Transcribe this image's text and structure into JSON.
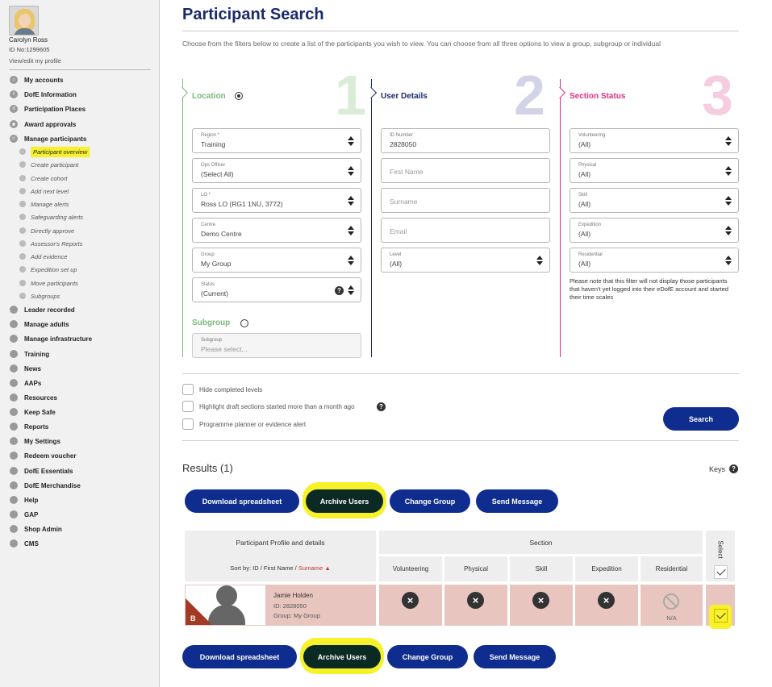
{
  "sidebar": {
    "user_name": "Carolyn Ross",
    "user_id": "ID No:1299605",
    "profile_link": "View/edit my profile",
    "nav": [
      {
        "label": "My accounts",
        "icon": "home-icon"
      },
      {
        "label": "DofE Information",
        "icon": "info-icon"
      },
      {
        "label": "Participation Places",
        "icon": "list-icon"
      },
      {
        "label": "Award approvals",
        "icon": "award-icon"
      },
      {
        "label": "Manage participants",
        "icon": "users-icon"
      }
    ],
    "sub_items": [
      "Participant overview",
      "Create participant",
      "Create cohort",
      "Add next level",
      "Manage alerts",
      "Safeguarding alerts",
      "Directly approve",
      "Assessor's Reports",
      "Add evidence",
      "Expedition set up",
      "Move participants",
      "Subgroups"
    ],
    "nav2": [
      "Leader recorded",
      "Manage adults",
      "Manage infrastructure",
      "Training",
      "News",
      "AAPs",
      "Resources",
      "Keep Safe",
      "Reports",
      "My Settings",
      "Redeem voucher",
      "DofE Essentials",
      "DofE Merchandise",
      "Help",
      "GAP",
      "Shop Admin",
      "CMS"
    ]
  },
  "main": {
    "title": "Participant Search",
    "intro": "Choose from the filters below to create a list of the participants you wish to view. You can choose from all three options to view a group, subgroup or individual",
    "columns": [
      {
        "heading": "Location",
        "number": "1",
        "color": "#7cb77a",
        "num_color": "#d9ecd6"
      },
      {
        "heading": "User Details",
        "number": "2",
        "color": "#1b2a6b",
        "num_color": "#d3d3e8"
      },
      {
        "heading": "Section Status",
        "number": "3",
        "color": "#e0317e",
        "num_color": "#f6cde0"
      }
    ],
    "location_fields": [
      {
        "label": "Region *",
        "value": "Training"
      },
      {
        "label": "Ops Officer",
        "value": "(Select All)"
      },
      {
        "label": "LO *",
        "value": "Ross LO (RG1 1NU, 3772)"
      },
      {
        "label": "Centre",
        "value": "Demo Centre"
      },
      {
        "label": "Group",
        "value": "My Group"
      },
      {
        "label": "Status",
        "value": "(Current)"
      }
    ],
    "subgroup": {
      "heading": "Subgroup",
      "label": "Subgroup",
      "placeholder": "Please select..."
    },
    "user_fields": [
      {
        "label": "ID Number",
        "value": "2828050"
      },
      {
        "placeholder": "First Name"
      },
      {
        "placeholder": "Surname"
      },
      {
        "placeholder": "Email"
      },
      {
        "label": "Level",
        "value": "(All)"
      }
    ],
    "status_fields": [
      {
        "label": "Volunteering",
        "value": "(All)"
      },
      {
        "label": "Physical",
        "value": "(All)"
      },
      {
        "label": "Skill",
        "value": "(All)"
      },
      {
        "label": "Expedition",
        "value": "(All)"
      },
      {
        "label": "Residential",
        "value": "(All)"
      }
    ],
    "status_note": "Please note that this filter will not display those participants that haven't yet logged into their eDofE account and started their time scales",
    "checkboxes": [
      "Hide completed levels",
      "Highlight draft sections started more than a month ago",
      "Programme planner or evidence alert"
    ],
    "search_button": "Search",
    "results_label": "Results (1)",
    "keys_label": "Keys",
    "actions": {
      "download": "Download spreadsheet",
      "archive": "Archive Users",
      "change_group": "Change Group",
      "send_message": "Send Message"
    },
    "table": {
      "profile_header": "Participant Profile and details",
      "sort_prefix": "Sort by: ID / First Name /",
      "sort_active": "Surname",
      "section_header": "Section",
      "select_header": "Select",
      "section_cols": [
        "Volunteering",
        "Physical",
        "Skill",
        "Expedition",
        "Residential"
      ],
      "rows": [
        {
          "name": "Jamie Holden",
          "id": "ID: 2828050",
          "group": "Group: My Group",
          "badge": "B",
          "statuses": [
            "x",
            "x",
            "x",
            "x",
            "na"
          ],
          "na_label": "N/A"
        }
      ]
    }
  },
  "colors": {
    "navy": "#0f2d8f",
    "highlight": "#f7f12a",
    "row_bg": "#e8c6bf"
  }
}
